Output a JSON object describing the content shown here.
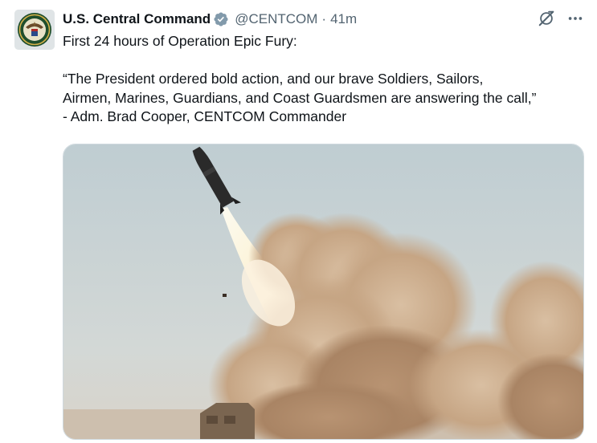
{
  "tweet": {
    "author": {
      "display_name": "U.S. Central Command",
      "handle": "@CENTCOM",
      "verified_badge_icon": "verified-badge-icon",
      "avatar_icon": "centcom-seal-icon"
    },
    "separator": "·",
    "time": "41m",
    "actions": {
      "grok_icon": "grok-icon",
      "more_icon": "more-icon"
    },
    "text": {
      "line1": "First 24 hours of Operation Epic Fury:",
      "line2": "“The President ordered bold action, and our brave Soldiers, Sailors,",
      "line3": "Airmen, Marines, Guardians, and Coast Guardsmen are answering the call,”",
      "line4": "- Adm. Brad Cooper, CENTCOM Commander"
    },
    "media": {
      "image_icon": "missile-launch-photo"
    }
  },
  "colors": {
    "text_primary": "#0f1419",
    "text_secondary": "#536471",
    "verified_blue": "#829aab",
    "sky": "#c8d2d6",
    "smoke": "#c9ab8a"
  }
}
